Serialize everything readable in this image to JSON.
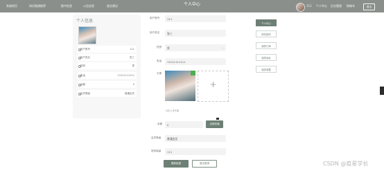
{
  "header": {
    "title": "个人中心",
    "nav": [
      "系统首页",
      "知识图谱推荐",
      "图书信息",
      "公告信息",
      "留言建议"
    ],
    "username": "111",
    "user_menu": [
      "个人中心",
      "后台管理",
      "购物车"
    ],
    "logout": "退出"
  },
  "profile_card": {
    "title": "个人信息",
    "rows": [
      {
        "label": "用户账号",
        "value": "111"
      },
      {
        "label": "用户姓名",
        "value": "张三"
      },
      {
        "label": "性别",
        "value": "男"
      },
      {
        "label": "电话",
        "value": "13111111111"
      },
      {
        "label": "余额",
        "value": "0"
      },
      {
        "label": "会员等级",
        "value": "普通会员"
      }
    ]
  },
  "form": {
    "account": {
      "label": "用户账号",
      "value": "111"
    },
    "name": {
      "label": "用户姓名",
      "value": "张三"
    },
    "gender": {
      "label": "性别",
      "value": "男"
    },
    "phone": {
      "label": "电话",
      "value": "13111111111"
    },
    "avatar": {
      "label": "头像",
      "hint": "点击上传头像"
    },
    "balance": {
      "label": "余额",
      "value": "0",
      "button": "点我充值"
    },
    "vip_level": {
      "label": "会员等级",
      "value": "普通会员"
    },
    "password": {
      "label": "密码保留",
      "value": "111"
    },
    "update_button": "更新信息",
    "exit_button": "退出登录"
  },
  "side_menu": [
    "个人中心",
    "修改密码",
    "我的订单",
    "我的地址",
    "我的收藏"
  ],
  "watermark": "CSDN @疫星学长",
  "colors": {
    "accent": "#6e8076",
    "header": "#8a8f8c"
  }
}
